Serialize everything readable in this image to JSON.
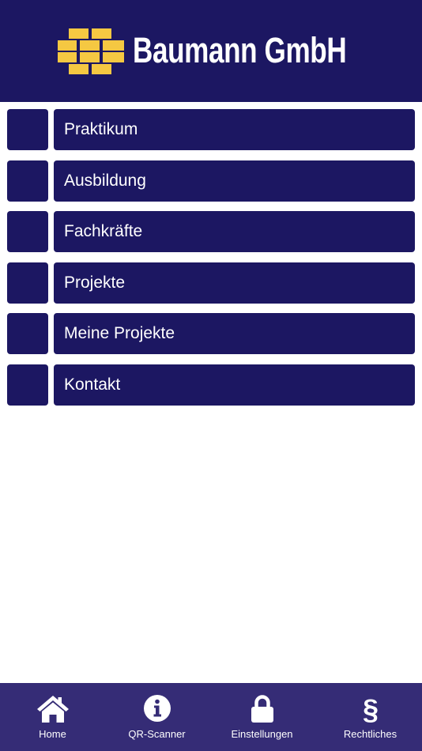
{
  "header": {
    "company_name": "Baumann GmbH",
    "logo_icon": "bricks-logo-icon",
    "brand_color": "#1c1762",
    "logo_color": "#f5c842"
  },
  "menu": {
    "items": [
      {
        "label": "Praktikum"
      },
      {
        "label": "Ausbildung"
      },
      {
        "label": "Fachkräfte"
      },
      {
        "label": "Projekte"
      },
      {
        "label": "Meine Projekte"
      },
      {
        "label": "Kontakt"
      }
    ]
  },
  "tabbar": {
    "background": "#352c76",
    "tabs": [
      {
        "label": "Home",
        "icon": "home-icon"
      },
      {
        "label": "QR-Scanner",
        "icon": "info-icon"
      },
      {
        "label": "Einstellungen",
        "icon": "lock-icon"
      },
      {
        "label": "Rechtliches",
        "icon": "section-sign-icon"
      }
    ]
  }
}
